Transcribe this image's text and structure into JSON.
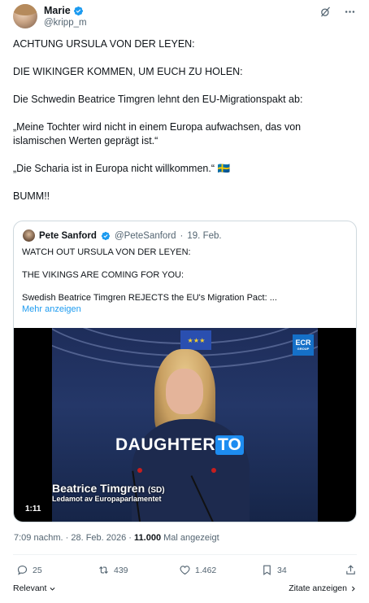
{
  "author": {
    "name": "Marie",
    "handle": "@kripp_m"
  },
  "header_icons": [
    "grok-icon",
    "more-icon"
  ],
  "tweet": {
    "paragraphs": [
      "ACHTUNG URSULA VON DER LEYEN:",
      "DIE WIKINGER KOMMEN, UM EUCH ZU HOLEN:",
      "Die Schwedin Beatrice Timgren lehnt den EU-Migrationspakt ab:",
      "„Meine Tochter wird nicht in einem Europa aufwachsen, das von islamischen Werten geprägt ist.“",
      "„Die Scharia ist in Europa nicht willkommen.“ 🇸🇪",
      "BUMM!!"
    ]
  },
  "quote": {
    "name": "Pete Sanford",
    "handle": "@PeteSanford",
    "separator": "·",
    "date": "19. Feb.",
    "paragraphs": [
      "WATCH OUT URSULA VON DER LEYEN:",
      "THE VIKINGS ARE COMING FOR YOU:",
      "Swedish Beatrice Timgren REJECTS the EU's Migration Pact:   ..."
    ],
    "more_link": "Mehr anzeigen",
    "video": {
      "caption_white": "DAUGHTER",
      "caption_blue": "TO",
      "lower_third_name": "Beatrice Timgren",
      "lower_third_party": "(SD)",
      "lower_third_role": "Ledamot av Europaparlamentet",
      "logo_text": "ECR",
      "logo_subtext": "GROUP",
      "timecode": "1:11"
    }
  },
  "meta": {
    "time": "7:09 nachm.",
    "separator": "·",
    "date": "28. Feb. 2026",
    "views_count": "11.000",
    "views_label": "Mal angezeigt"
  },
  "actions": {
    "replies": "25",
    "reposts": "439",
    "likes": "1.462",
    "bookmarks": "34"
  },
  "footer": {
    "sort_label": "Relevant",
    "quotes_link": "Zitate anzeigen"
  },
  "colors": {
    "accent": "#1d9bf0",
    "text": "#0f1419",
    "muted": "#536471",
    "border": "#cfd9de"
  }
}
